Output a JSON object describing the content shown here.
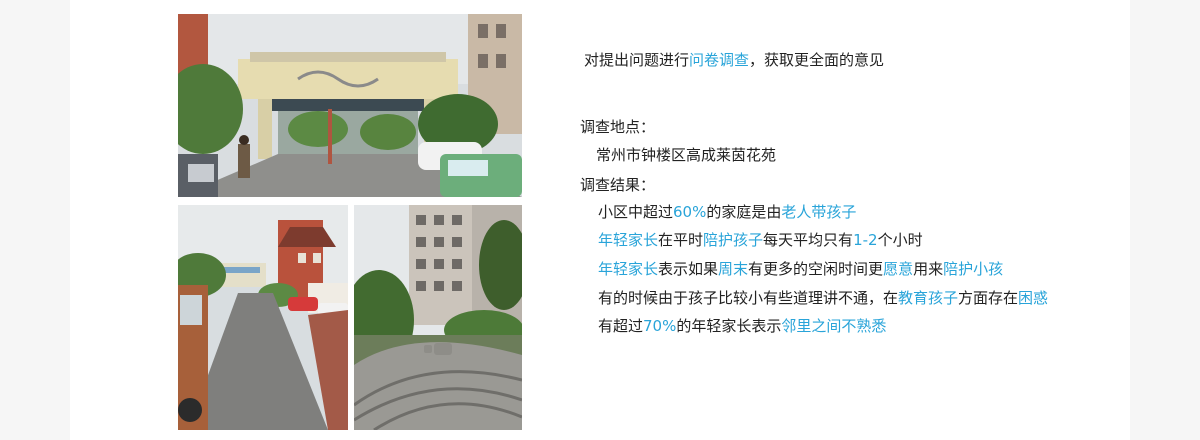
{
  "intro": {
    "prefix": "对提出问题进行",
    "highlight": "问卷调查",
    "suffix": "，获取更全面的意见"
  },
  "location": {
    "label": "调查地点：",
    "value": "常州市钟楼区高成莱茵花苑"
  },
  "results": {
    "label": "调查结果：",
    "line1": {
      "a": "小区中超过",
      "b": "60%",
      "c": "的家庭是由",
      "d": "老人带孩子"
    },
    "line2": {
      "a": "年轻家长",
      "b": "在平时",
      "c": "陪护孩子",
      "d": "每天平均只有",
      "e": "1-2",
      "f": "个小时"
    },
    "line3": {
      "a": "年轻家长",
      "b": "表示如果",
      "c": "周末",
      "d": "有更多的空闲时间更",
      "e": "愿意",
      "f": "用来",
      "g": "陪护小孩"
    },
    "line4": {
      "a": "有的时候由于孩子比较小有些道理讲不通，在",
      "b": "教育孩子",
      "c": "方面存在",
      "d": "困惑"
    },
    "line5": {
      "a": "有超过",
      "b": "70%",
      "c": "的年轻家长表示",
      "d": "邻里之间不熟悉"
    }
  },
  "colors": {
    "highlight": "#29a4d9",
    "text": "#222222"
  }
}
